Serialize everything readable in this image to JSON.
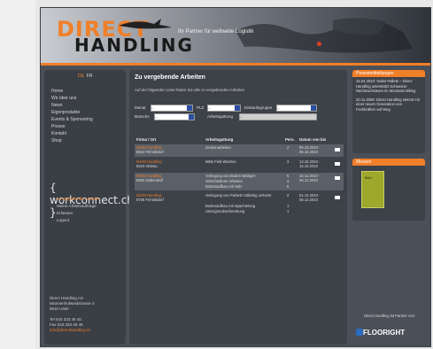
{
  "header": {
    "logo_line1": "DIRECT",
    "logo_line2": "HANDLING",
    "tagline": "Ihr Partner für weltweite Logistik"
  },
  "lang": {
    "de": "DE",
    "fr": "FR"
  },
  "sidebar": {
    "items": [
      "Home",
      "Wir über uns",
      "News",
      "Eigenprodukte",
      "Events & Sponsoring",
      "Presse",
      "Kontakt",
      "",
      "Shop"
    ],
    "workconnect": "{ workconnect.ch }",
    "subitems": [
      "Zu vergebende Arbeiten",
      "Meine Arbeitsaufträge",
      "Erfassen",
      "Logout"
    ],
    "address": [
      "Direct Handling AG",
      "Wannenhofweidstrasse 3",
      "8610 Uster",
      "",
      "Tel 043 333 45 40",
      "Fax 043 333 45 49",
      "info@directhandling.ch"
    ]
  },
  "main": {
    "title": "Zu vergebende Arbeiten",
    "intro": "Auf der folgenden Liste finden Sie alle zu vergebenden Arbeiten.",
    "filters": {
      "monat_label": "Monat",
      "plz_label": "PLZ",
      "einkauf_label": "Einkaufsgruppe",
      "branche_label": "Branche",
      "arbeit_label": "Arbeitsgattung",
      "sel_value": "--"
    },
    "columns": [
      "Firma / Ort",
      "Arbeitsgattung",
      "Pers.",
      "Datum von bis"
    ],
    "rows": [
      {
        "firma": "Direkt Handling",
        "ort": "8610 Fehraltdorf",
        "arbeit": [
          "Zeckenarbeiten"
        ],
        "pers": [
          "2"
        ],
        "datum": [
          "05.10.2010 -",
          "06.10.2010"
        ],
        "alt": true
      },
      {
        "firma": "Direkt Handling",
        "ort": "8310 Hittnau",
        "arbeit": [
          "Mitte Feld Wachen"
        ],
        "pers": [
          "3"
        ],
        "datum": [
          "13.10.2010 -",
          "15.10.2010"
        ],
        "alt": false
      },
      {
        "firma": "Direkt Handling",
        "ort": "8600 Dübendorf",
        "arbeit": [
          "Verlegung von Boden Belägen",
          "Verschiedene Arbeiten",
          "Bodenaufbau mit Holz"
        ],
        "pers": [
          "6",
          "4",
          "6"
        ],
        "datum": [
          "16.11.2010 -",
          "26.11.2010"
        ],
        "alt": true
      },
      {
        "firma": "Direkt Handling",
        "ort": "8706 Fehraltdorf",
        "arbeit": [
          "Verlegung von Parkett mitfarbig verleimt",
          "Bodenaufbau mit Spachtelung",
          "Untergrundvorbereitung"
        ],
        "pers": [
          "2",
          "1",
          "1"
        ],
        "datum": [
          "01.12.2010 -",
          "08.12.2010"
        ],
        "alt": false
      }
    ]
  },
  "right": {
    "press_title": "Pressemitteilungen",
    "press_items": [
      "15.04.2010: Swiss Pallets – Direct Handling unterstützt Schweizer Nachwuchsteam im Mountain Biking",
      "20.11.2008: Direct Handling stimmt mit einer neuen Generation von Fachkräften auf Weg"
    ],
    "messe_title": "Messen",
    "messe_label": "BAU",
    "floor_text": "Direct Handling ist Partner von:",
    "floor_logo": "FLOORIGHT"
  }
}
